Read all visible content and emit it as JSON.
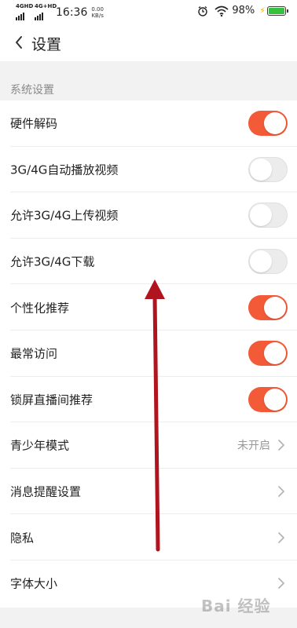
{
  "status_bar": {
    "signal1_tag": "4GHD",
    "signal2_tag": "4G+HD",
    "time": "16:36",
    "net_speed_value": "0.00",
    "net_speed_unit": "KB/s",
    "battery_percent": "98%",
    "battery_level": 0.98,
    "battery_color": "#35c13e"
  },
  "header": {
    "back_icon": "chevron-left-icon",
    "title": "设置"
  },
  "section": {
    "title": "系统设置"
  },
  "settings": [
    {
      "label": "硬件解码",
      "type": "toggle",
      "on": true
    },
    {
      "label": "3G/4G自动播放视频",
      "type": "toggle",
      "on": false
    },
    {
      "label": "允许3G/4G上传视频",
      "type": "toggle",
      "on": false
    },
    {
      "label": "允许3G/4G下载",
      "type": "toggle",
      "on": false
    },
    {
      "label": "个性化推荐",
      "type": "toggle",
      "on": true
    },
    {
      "label": "最常访问",
      "type": "toggle",
      "on": true
    },
    {
      "label": "锁屏直播间推荐",
      "type": "toggle",
      "on": true
    },
    {
      "label": "青少年模式",
      "type": "link",
      "value": "未开启"
    },
    {
      "label": "消息提醒设置",
      "type": "link"
    },
    {
      "label": "隐私",
      "type": "link"
    },
    {
      "label": "字体大小",
      "type": "link"
    }
  ],
  "colors": {
    "accent": "#f25a38",
    "annotation_arrow": "#b0141e"
  },
  "watermark": "Bai 经验"
}
